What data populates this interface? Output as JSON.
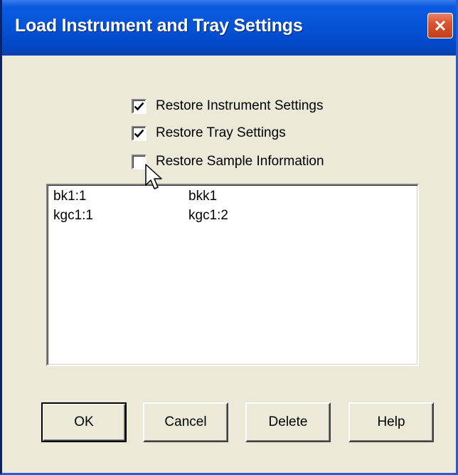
{
  "window": {
    "title": "Load Instrument and Tray Settings",
    "close_icon": "close-icon"
  },
  "options": [
    {
      "label": "Restore Instrument Settings",
      "checked": true
    },
    {
      "label": "Restore Tray Settings",
      "checked": true
    },
    {
      "label": "Restore Sample Information",
      "checked": false
    }
  ],
  "list": {
    "items": [
      {
        "col1": "bk1:1",
        "col2": "bkk1"
      },
      {
        "col1": "kgc1:1",
        "col2": "kgc1:2"
      }
    ]
  },
  "buttons": {
    "ok": "OK",
    "cancel": "Cancel",
    "delete": "Delete",
    "help": "Help"
  },
  "colors": {
    "titlebar": "#0554d8",
    "dialog_bg": "#ece9d8",
    "close_button": "#d9532f"
  }
}
